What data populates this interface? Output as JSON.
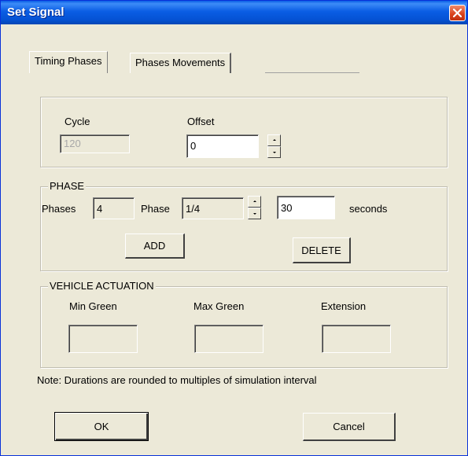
{
  "window": {
    "title": "Set Signal"
  },
  "tabs": [
    {
      "label": "Timing Phases",
      "active": true
    },
    {
      "label": "Phases Movements",
      "active": false
    }
  ],
  "cycle_offset": {
    "cycle_label": "Cycle",
    "cycle_value": "120",
    "offset_label": "Offset",
    "offset_value": "0"
  },
  "phase": {
    "group_label": "PHASE",
    "phases_label": "Phases",
    "phases_value": "4",
    "phase_label": "Phase",
    "phase_value": "1/4",
    "duration_value": "30",
    "seconds_label": "seconds",
    "add_label": "ADD",
    "delete_label": "DELETE"
  },
  "vehicle_actuation": {
    "group_label": "VEHICLE ACTUATION",
    "min_green_label": "Min Green",
    "min_green_value": "",
    "max_green_label": "Max Green",
    "max_green_value": "",
    "extension_label": "Extension",
    "extension_value": ""
  },
  "note": "Note: Durations are rounded to multiples of simulation interval",
  "buttons": {
    "ok_label": "OK",
    "cancel_label": "Cancel"
  },
  "icons": {
    "close": "close-icon",
    "spin_up": "arrow-up-icon",
    "spin_down": "arrow-down-icon"
  },
  "colors": {
    "titlebar": "#0a5de4",
    "dialog_bg": "#ece9d8",
    "close_button": "#d8401a"
  }
}
